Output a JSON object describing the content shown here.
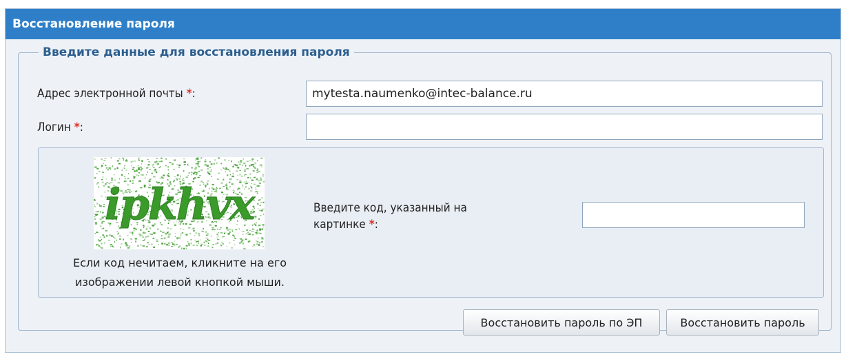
{
  "panel": {
    "title": "Восстановление пароля"
  },
  "form": {
    "legend": "Введите данные для восстановления пароля",
    "email_label": "Адрес электронной почты",
    "email_value": "mytesta.naumenko@intec-balance.ru",
    "login_label": "Логин",
    "login_value": "",
    "required_mark": "*",
    "colon": ":"
  },
  "captcha": {
    "code": "ipkhvx",
    "prompt_line1": "Введите код, указанный на",
    "prompt_line2": "картинке",
    "note_line1": "Если код нечитаем, кликните на его",
    "note_line2": "изображении левой кнопкой мыши.",
    "input_value": ""
  },
  "buttons": {
    "restore_by_ep": "Восстановить пароль по ЭП",
    "restore": "Восстановить пароль"
  },
  "colors": {
    "header_bg": "#2f7fc8",
    "panel_bg": "#eef2f7",
    "legend_text": "#2d5f8f",
    "required": "#e0302a",
    "captcha_text": "#3a9a2a"
  }
}
